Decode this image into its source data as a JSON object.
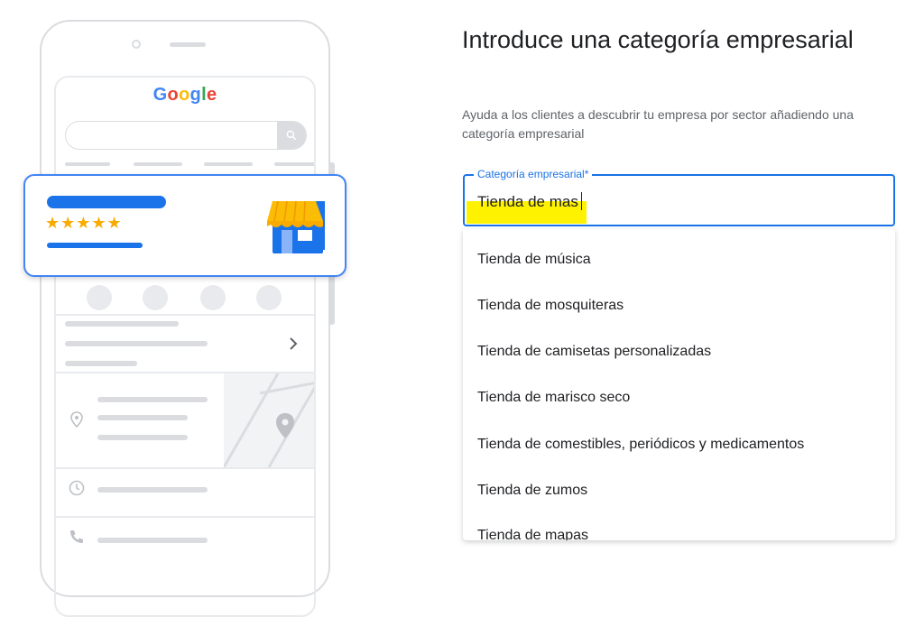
{
  "illustration": {
    "logo": [
      "G",
      "o",
      "o",
      "g",
      "l",
      "e"
    ],
    "rating_stars": "★★★★★",
    "colors": {
      "brand_blue": "#1a73e8",
      "star_gold": "#F9AB00",
      "awning_yellow": "#FBBC05"
    }
  },
  "form": {
    "title": "Introduce una categoría empresarial",
    "subtitle": "Ayuda a los clientes a descubrir tu empresa por sector añadiendo una categoría empresarial",
    "field_label": "Categoría empresarial*",
    "field_value": "Tienda de mas",
    "suggestions": [
      "Tienda de música",
      "Tienda de mosquiteras",
      "Tienda de camisetas personalizadas",
      "Tienda de marisco seco",
      "Tienda de comestibles, periódicos y medicamentos",
      "Tienda de zumos",
      "Tienda de mapas"
    ]
  }
}
